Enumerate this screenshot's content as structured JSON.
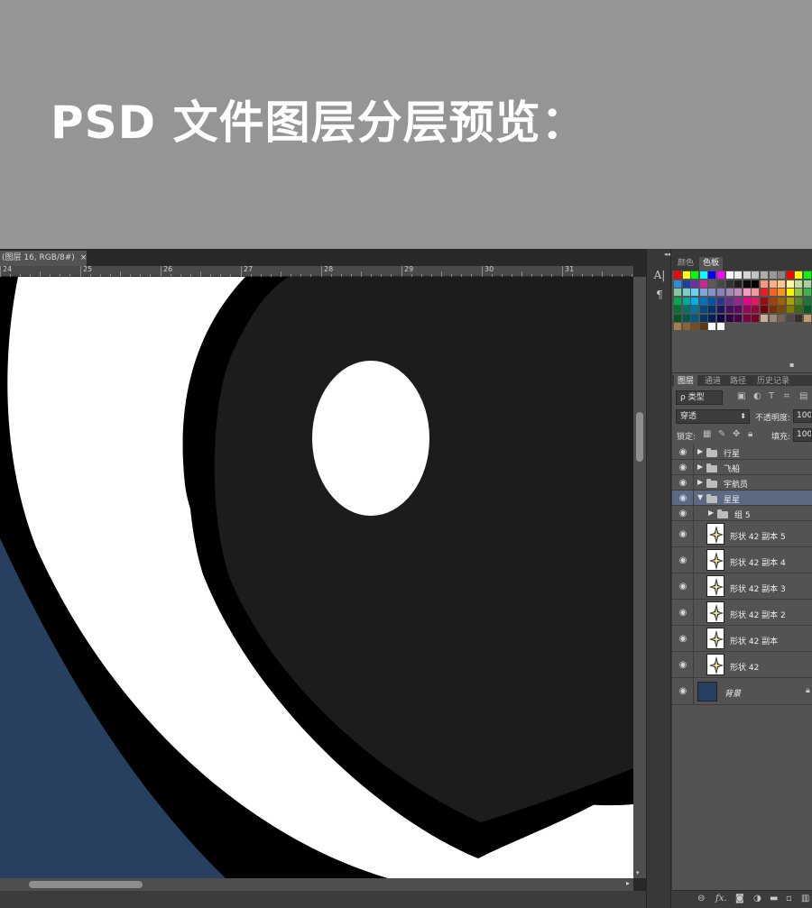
{
  "banner": {
    "title": "PSD 文件图层分层预览："
  },
  "document": {
    "tab_title": "(图层 16, RGB/8#)",
    "tab_close": "×",
    "ruler_ticks": [
      "24",
      "25",
      "26",
      "27",
      "28",
      "29",
      "30",
      "31"
    ],
    "scroll_down_arrow": "▾",
    "scroll_right_arrow": "▸"
  },
  "toolstrip": {
    "collapse": "◂◂",
    "tools": [
      {
        "name": "character-icon",
        "glyph": "A|"
      },
      {
        "name": "paragraph-icon",
        "glyph": "¶"
      }
    ]
  },
  "color_panel": {
    "collapse": "▸▸",
    "tabs": [
      {
        "label": "颜色",
        "active": false
      },
      {
        "label": "色板",
        "active": true
      }
    ]
  },
  "layers_panel": {
    "tabs": [
      {
        "label": "图层",
        "active": true
      },
      {
        "label": "通道",
        "active": false
      },
      {
        "label": "路径",
        "active": false
      },
      {
        "label": "历史记录",
        "active": false
      }
    ],
    "filter_kind": "ρ 类型",
    "blend_mode": "穿透",
    "opacity_label": "不透明度:",
    "opacity_value": "100%",
    "lock_label": "锁定:",
    "fill_label": "填充:",
    "fill_value": "100%",
    "layers": [
      {
        "name": "行星",
        "type": "group",
        "expanded": false,
        "indent": 0,
        "selected": false
      },
      {
        "name": "飞船",
        "type": "group",
        "expanded": false,
        "indent": 0,
        "selected": false
      },
      {
        "name": "宇航员",
        "type": "group",
        "expanded": false,
        "indent": 0,
        "selected": false
      },
      {
        "name": "星星",
        "type": "group",
        "expanded": true,
        "indent": 0,
        "selected": true
      },
      {
        "name": "组 5",
        "type": "group",
        "expanded": false,
        "indent": 1,
        "selected": false
      },
      {
        "name": "形状 42 副本 5",
        "type": "shape",
        "indent": 1,
        "selected": false
      },
      {
        "name": "形状 42 副本 4",
        "type": "shape",
        "indent": 1,
        "selected": false
      },
      {
        "name": "形状 42 副本 3",
        "type": "shape",
        "indent": 1,
        "selected": false
      },
      {
        "name": "形状 42 副本 2",
        "type": "shape",
        "indent": 1,
        "selected": false
      },
      {
        "name": "形状 42 副本",
        "type": "shape",
        "indent": 1,
        "selected": false
      },
      {
        "name": "形状 42",
        "type": "shape",
        "indent": 1,
        "selected": false
      },
      {
        "name": "背景",
        "type": "background",
        "indent": 0,
        "selected": false,
        "locked": true
      }
    ],
    "bottom_icons": [
      "link-icon",
      "fx-icon",
      "mask-icon",
      "adjustment-icon",
      "new-group-icon",
      "new-layer-icon",
      "trash-icon"
    ],
    "bottom_fx": "fx."
  },
  "colors": {
    "canvas_navy": "#27405f",
    "canvas_dark": "#1c1c1c",
    "selected_row": "#5b6a80",
    "panel_bg": "#535353"
  }
}
